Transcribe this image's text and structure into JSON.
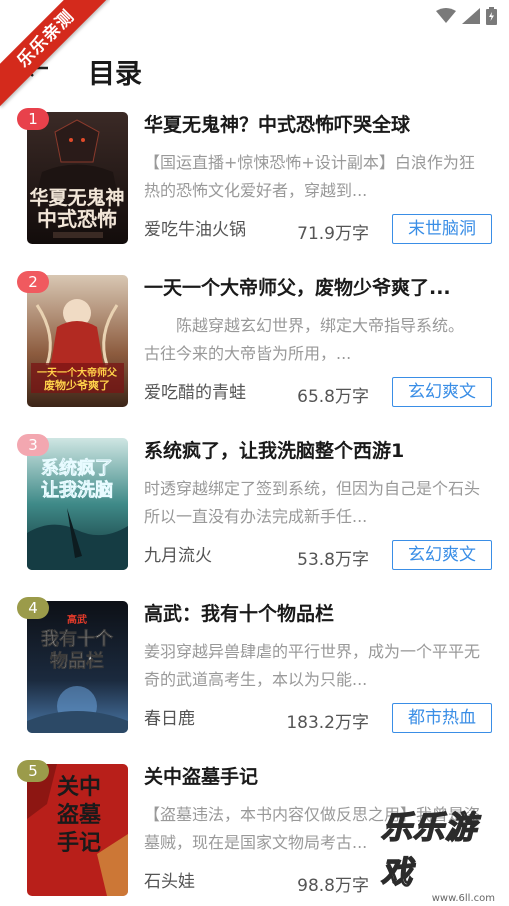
{
  "ribbon": {
    "text": "乐乐亲测"
  },
  "header": {
    "title": "目录"
  },
  "books": [
    {
      "rank": "1",
      "rank_color": "#e8414b",
      "title": "华夏无鬼神？中式恐怖吓哭全球",
      "desc": "【国运直播+惊悚恐怖+设计副本】白浪作为狂热的恐怖文化爱好者，穿越到...",
      "author": "爱吃牛油火锅",
      "words": "71.9万字",
      "tag": "末世脑洞",
      "cover_text": "华夏无鬼神中式恐怖"
    },
    {
      "rank": "2",
      "rank_color": "#f05a5f",
      "title": "一天一个大帝师父，废物少爷爽了...",
      "desc": "　　陈越穿越玄幻世界，绑定大帝指导系统。　　古往今来的大帝皆为所用，...",
      "author": "爱吃醋的青蛙",
      "words": "65.8万字",
      "tag": "玄幻爽文",
      "cover_text": "一天一个大帝师父 废物少爷爽了"
    },
    {
      "rank": "3",
      "rank_color": "#f3a7b0",
      "title": "系统疯了，让我洗脑整个西游1",
      "desc": "时透穿越绑定了签到系统，但因为自己是个石头所以一直没有办法完成新手任...",
      "author": "九月流火",
      "words": "53.8万字",
      "tag": "玄幻爽文",
      "cover_text": "系统疯了让我洗脑"
    },
    {
      "rank": "4",
      "rank_color": "#9b9b4a",
      "title": "高武：我有十个物品栏",
      "desc": "姜羽穿越异兽肆虐的平行世界，成为一个平平无奇的武道高考生，本以为只能...",
      "author": "春日鹿",
      "words": "183.2万字",
      "tag": "都市热血",
      "cover_text": "我有十个物品栏"
    },
    {
      "rank": "5",
      "rank_color": "#9b9b4a",
      "title": "关中盗墓手记",
      "desc": "【盗墓违法，本书内容仅做反思之用】我曾是盗墓贼，现在是国家文物局考古...",
      "author": "石头娃",
      "words": "98.8万字",
      "tag": "",
      "cover_text": "关中盗墓手记"
    }
  ],
  "watermark": {
    "text": "乐乐游戏",
    "url": "www.6ll.com"
  }
}
